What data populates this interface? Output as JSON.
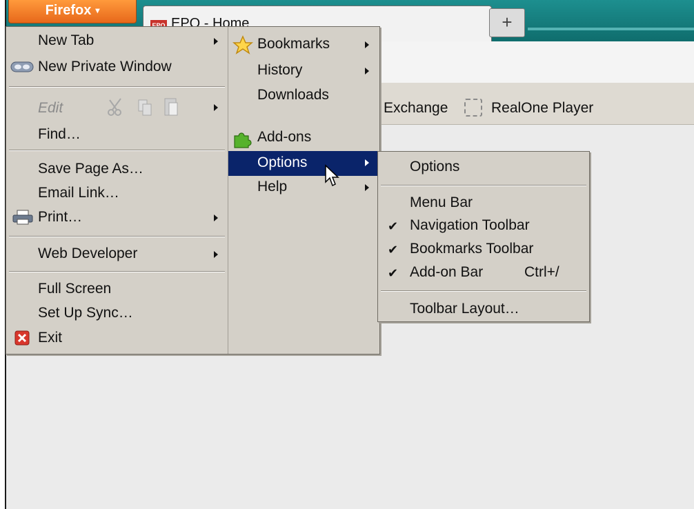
{
  "firefox_button": {
    "label": "Firefox",
    "arrow": "▾"
  },
  "tab": {
    "favicon_text": "EPO",
    "title": "EPO - Home",
    "new_tab_glyph": "+"
  },
  "bookmarks_bar": {
    "items": [
      "Exchange",
      "RealOne Player"
    ]
  },
  "menu_left": [
    {
      "label": "New Tab",
      "submenu": true
    },
    {
      "label": "New Private Window",
      "icon": "mask-icon"
    },
    {
      "label": "Edit",
      "disabled": true,
      "submenu": true
    },
    {
      "label": "Find…"
    },
    {
      "label": "Save Page As…"
    },
    {
      "label": "Email Link…"
    },
    {
      "label": "Print…",
      "icon": "printer-icon",
      "submenu": true
    },
    {
      "label": "Web Developer",
      "submenu": true
    },
    {
      "label": "Full Screen"
    },
    {
      "label": "Set Up Sync…"
    },
    {
      "label": "Exit",
      "icon": "exit-icon"
    }
  ],
  "menu_right": [
    {
      "label": "Bookmarks",
      "icon": "star-icon",
      "submenu": true
    },
    {
      "label": "History",
      "submenu": true
    },
    {
      "label": "Downloads"
    },
    {
      "label": "Add-ons",
      "icon": "puzzle-icon"
    },
    {
      "label": "Options",
      "submenu": true,
      "highlighted": true
    },
    {
      "label": "Help",
      "submenu": true
    }
  ],
  "options_submenu": [
    {
      "label": "Options"
    },
    {
      "label": "Menu Bar",
      "checked": false
    },
    {
      "label": "Navigation Toolbar",
      "checked": true
    },
    {
      "label": "Bookmarks Toolbar",
      "checked": true
    },
    {
      "label": "Add-on Bar",
      "checked": true,
      "shortcut": "Ctrl+/"
    },
    {
      "label": "Toolbar Layout…"
    }
  ],
  "check_glyph": "✔",
  "colors": {
    "menu_bg": "#d4d0c8",
    "highlight": "#0a246a",
    "firefox_orange": "#e7681b",
    "tabstrip": "#0f6d6d"
  }
}
